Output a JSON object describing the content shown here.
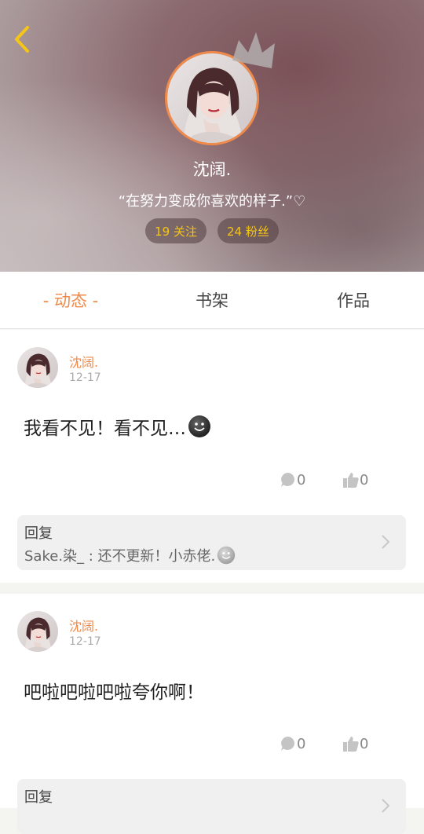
{
  "profile": {
    "name": "沈阔.",
    "signature": "“在努力变成你喜欢的样子.”♡",
    "following": "19 关注",
    "followers": "24 粉丝"
  },
  "tabs": [
    {
      "label": "- 动态 -",
      "active": true
    },
    {
      "label": "书架",
      "active": false
    },
    {
      "label": "作品",
      "active": false
    }
  ],
  "posts": [
    {
      "author": "沈阔.",
      "date": "12-17",
      "text": "我看不见！看不见…",
      "emoji": "smiley-icon",
      "comments": "0",
      "likes": "0",
      "reply_label": "回复",
      "reply_text": "Sake.染_ : 还不更新！小赤佬."
    },
    {
      "author": "沈阔.",
      "date": "12-17",
      "text": "吧啦吧啦吧啦夸你啊！",
      "comments": "0",
      "likes": "0",
      "reply_label": "回复"
    }
  ],
  "colors": {
    "accent": "#f08a4b",
    "stat_text": "#f5c518"
  }
}
